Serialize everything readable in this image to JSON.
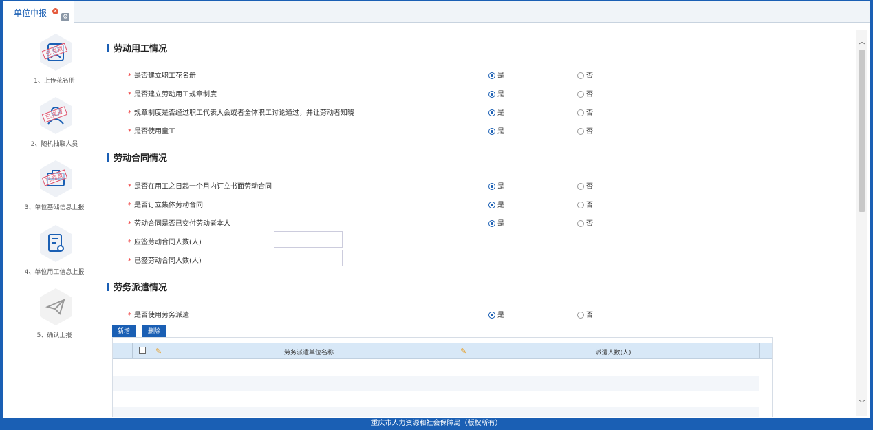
{
  "tab": {
    "label": "单位申报"
  },
  "steps": [
    {
      "label": "1、上传花名册",
      "stamp": "已完成",
      "done": true
    },
    {
      "label": "2、随机抽取人员",
      "stamp": "已完成",
      "done": true
    },
    {
      "label": "3、单位基础信息上报",
      "stamp": "已完成",
      "done": true
    },
    {
      "label": "4、单位用工信息上报",
      "stamp": "",
      "done": false
    },
    {
      "label": "5、确认上报",
      "stamp": "",
      "done": false
    }
  ],
  "sections": {
    "employment": {
      "title": "劳动用工情况",
      "questions": [
        {
          "text": "是否建立职工花名册",
          "yes": "是",
          "no": "否",
          "selected": "yes"
        },
        {
          "text": "是否建立劳动用工规章制度",
          "yes": "是",
          "no": "否",
          "selected": "yes"
        },
        {
          "text": "规章制度是否经过职工代表大会或者全体职工讨论通过，并让劳动者知晓",
          "yes": "是",
          "no": "否",
          "selected": "yes"
        },
        {
          "text": "是否使用童工",
          "yes": "是",
          "no": "否",
          "selected": "yes"
        }
      ]
    },
    "contract": {
      "title": "劳动合同情况",
      "questions": [
        {
          "text": "是否在用工之日起一个月内订立书面劳动合同",
          "yes": "是",
          "no": "否",
          "selected": "yes"
        },
        {
          "text": "是否订立集体劳动合同",
          "yes": "是",
          "no": "否",
          "selected": "yes"
        },
        {
          "text": "劳动合同是否已交付劳动者本人",
          "yes": "是",
          "no": "否",
          "selected": "yes"
        }
      ],
      "fields": [
        {
          "label": "应签劳动合同人数(人)",
          "value": ""
        },
        {
          "label": "已签劳动合同人数(人)",
          "value": ""
        }
      ]
    },
    "dispatch": {
      "title": "劳务派遣情况",
      "questions": [
        {
          "text": "是否使用劳务派遣",
          "yes": "是",
          "no": "否",
          "selected": "yes"
        }
      ],
      "buttons": {
        "add": "新增",
        "delete": "删除"
      },
      "table": {
        "columns": [
          "劳务派遣单位名称",
          "派遣人数(人)"
        ]
      }
    }
  },
  "footer": {
    "text": "重庆市人力资源和社会保障局（版权所有）"
  },
  "colors": {
    "accent": "#1a5fb4",
    "required": "#e33333",
    "stamp": "#e0506a"
  }
}
